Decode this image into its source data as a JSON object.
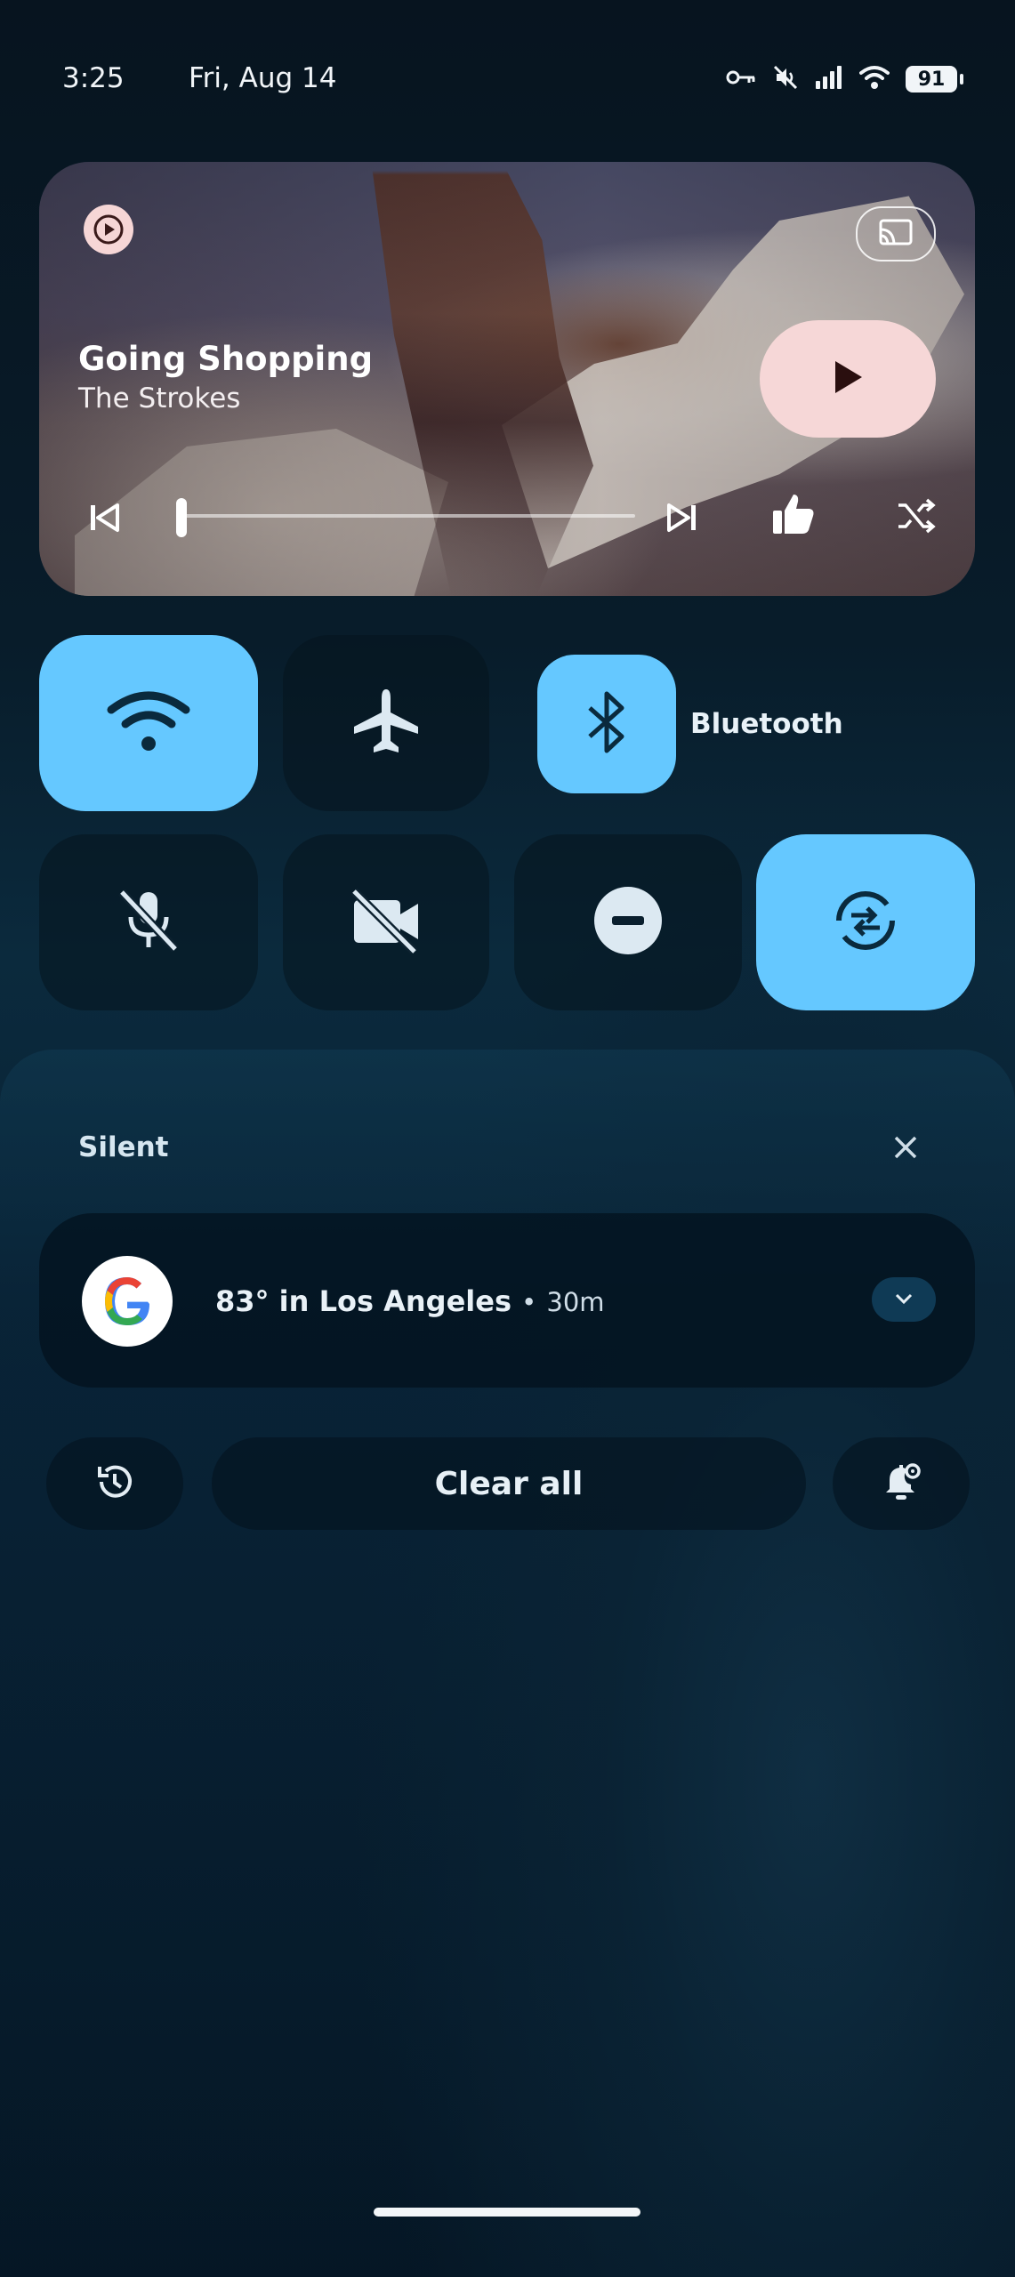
{
  "status_bar": {
    "time": "3:25",
    "date": "Fri, Aug 14",
    "battery": "91",
    "icons": [
      "vpn-key-icon",
      "mute-icon",
      "signal-icon",
      "wifi-icon",
      "battery-icon"
    ]
  },
  "media": {
    "title": "Going Shopping",
    "artist": "The Strokes",
    "progress": 0.0,
    "app_icon": "play-circle-icon",
    "controls": [
      "previous-icon",
      "next-icon",
      "thumbs-up-icon",
      "shuffle-icon",
      "cast-icon",
      "play-icon"
    ],
    "play_button_color": "#f6d7d7"
  },
  "quick_settings": {
    "tiles": [
      {
        "name": "wifi",
        "icon": "wifi-icon",
        "active": true
      },
      {
        "name": "airplane-mode",
        "icon": "airplane-icon",
        "active": false
      },
      {
        "name": "bluetooth",
        "icon": "bluetooth-icon",
        "active": true,
        "label": "Bluetooth"
      },
      {
        "name": "microphone",
        "icon": "mic-off-icon",
        "active": false
      },
      {
        "name": "camera",
        "icon": "camera-off-icon",
        "active": false
      },
      {
        "name": "do-not-disturb",
        "icon": "dnd-icon",
        "active": false
      },
      {
        "name": "data-saver",
        "icon": "sync-icon",
        "active": true
      }
    ],
    "active_color": "#65c8ff"
  },
  "notifications": {
    "section_label": "Silent",
    "items": [
      {
        "app_icon": "google-g-icon",
        "text": "83° in Los Angeles",
        "separator": "•",
        "time": "30m"
      }
    ],
    "clear_all_label": "Clear all"
  }
}
